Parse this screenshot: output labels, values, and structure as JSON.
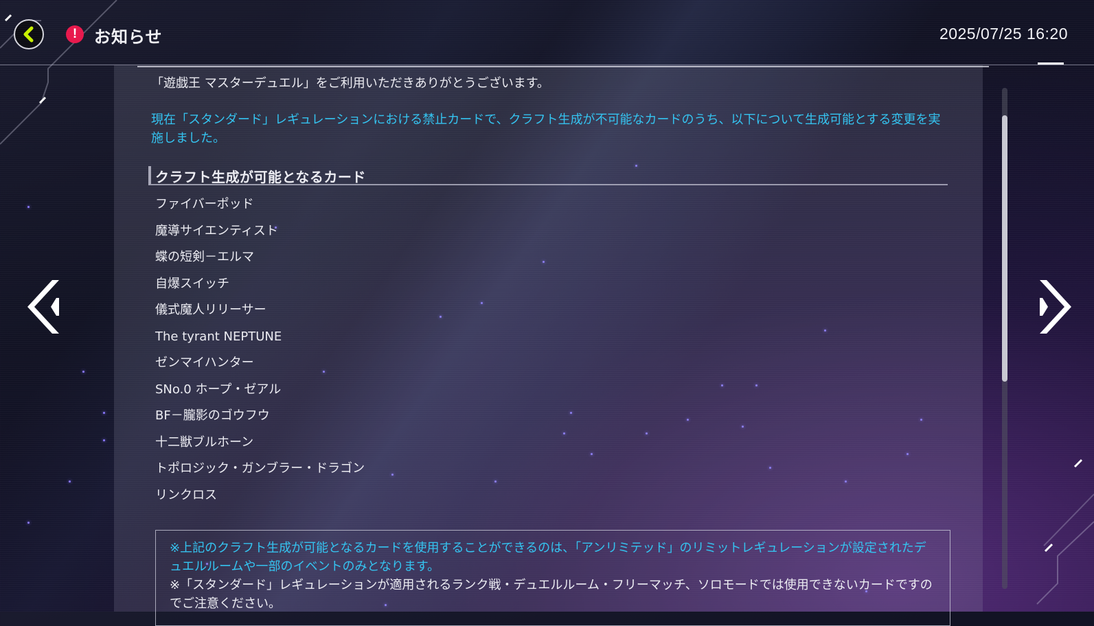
{
  "header": {
    "back_icon": "chevron-left-icon",
    "notice_icon": "exclamation-icon",
    "notice_icon_glyph": "!",
    "title": "お知らせ",
    "datetime": "2025/07/25 16:20"
  },
  "notice": {
    "intro": "「遊戯王 マスターデュエル」をご利用いただきありがとうございます。",
    "highlight": "現在「スタンダード」レギュレーションにおける禁止カードで、クラフト生成が不可能なカードのうち、以下について生成可能とする変更を実施しました。",
    "section_heading": "クラフト生成が可能となるカード",
    "cards": [
      "ファイバーポッド",
      "魔導サイエンティスト",
      "蝶の短剣－エルマ",
      "自爆スイッチ",
      "儀式魔人リリーサー",
      "The tyrant NEPTUNE",
      "ゼンマイハンター",
      "SNo.0 ホープ・ゼアル",
      "BF－朧影のゴウフウ",
      "十二獣ブルホーン",
      "トポロジック・ガンブラー・ドラゴン",
      "リンクロス"
    ],
    "note_cyan": "※上記のクラフト生成が可能となるカードを使用することができるのは、「アンリミテッド」のリミットレギュレーションが設定されたデュエルルームや一部のイベントのみとなります。",
    "note_white": "※「スタンダード」レギュレーションが適用されるランク戦・デュエルルーム・フリーマッチ、ソロモードでは使用できないカードですのでご注意ください。"
  },
  "nav": {
    "prev_icon": "double-chevron-left-icon",
    "next_icon": "chevron-right-icon"
  },
  "colors": {
    "accent_cyan": "#33c3f0",
    "back_arrow": "#c8f000",
    "notice_red": "#e8184c"
  }
}
